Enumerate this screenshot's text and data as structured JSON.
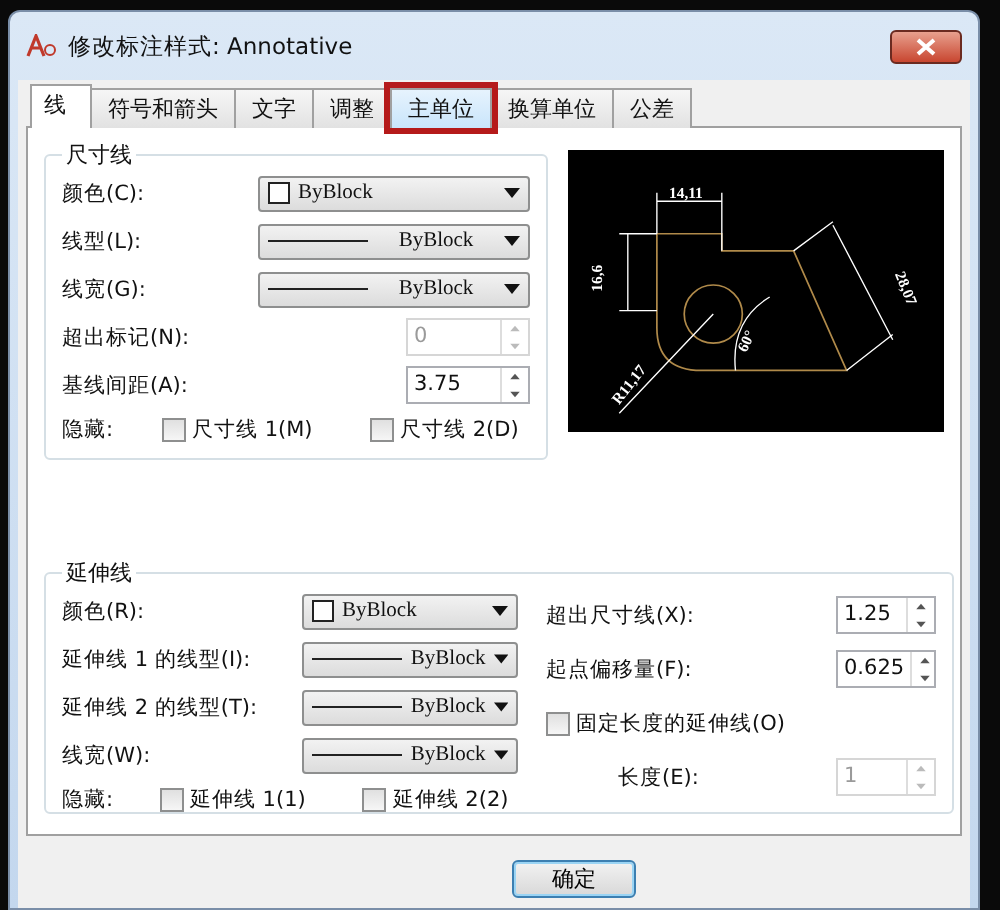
{
  "window": {
    "title": "修改标注样式: Annotative"
  },
  "tabs": [
    {
      "label": "线",
      "selected": true,
      "highlighted": false
    },
    {
      "label": "符号和箭头",
      "selected": false,
      "highlighted": false
    },
    {
      "label": "文字",
      "selected": false,
      "highlighted": false
    },
    {
      "label": "调整",
      "selected": false,
      "highlighted": false
    },
    {
      "label": "主单位",
      "selected": false,
      "highlighted": true
    },
    {
      "label": "换算单位",
      "selected": false,
      "highlighted": false
    },
    {
      "label": "公差",
      "selected": false,
      "highlighted": false
    }
  ],
  "dimension_lines": {
    "title": "尺寸线",
    "fields": [
      {
        "kind": "color_combo",
        "label": "颜色(C):",
        "value": "ByBlock"
      },
      {
        "kind": "line_combo",
        "label": "线型(L):",
        "value": "ByBlock"
      },
      {
        "kind": "line_combo",
        "label": "线宽(G):",
        "value": "ByBlock"
      },
      {
        "kind": "spinner",
        "label": "超出标记(N):",
        "value": "0",
        "disabled": true
      },
      {
        "kind": "spinner",
        "label": "基线间距(A):",
        "value": "3.75",
        "disabled": false
      }
    ],
    "hide": {
      "label": "隐藏:",
      "options": [
        {
          "label": "尺寸线 1(M)",
          "checked": false
        },
        {
          "label": "尺寸线 2(D)",
          "checked": false
        }
      ]
    }
  },
  "preview": {
    "labels": [
      "14,11",
      "16,6",
      "28,07",
      "60°",
      "R11,17"
    ]
  },
  "extension_lines": {
    "title": "延伸线",
    "fields": [
      {
        "kind": "color_combo",
        "label": "颜色(R):",
        "value": "ByBlock"
      },
      {
        "kind": "line_combo",
        "label": "延伸线 1 的线型(I):",
        "value": "ByBlock"
      },
      {
        "kind": "line_combo",
        "label": "延伸线 2 的线型(T):",
        "value": "ByBlock"
      },
      {
        "kind": "line_combo",
        "label": "线宽(W):",
        "value": "ByBlock"
      }
    ],
    "hide": {
      "label": "隐藏:",
      "options": [
        {
          "label": "延伸线 1(1)",
          "checked": false
        },
        {
          "label": "延伸线 2(2)",
          "checked": false
        }
      ]
    },
    "right_fields": [
      {
        "kind": "spinner",
        "label": "超出尺寸线(X):",
        "value": "1.25",
        "disabled": false
      },
      {
        "kind": "spinner",
        "label": "起点偏移量(F):",
        "value": "0.625",
        "disabled": false
      },
      {
        "kind": "checkbox",
        "label": "固定长度的延伸线(O)",
        "checked": false
      },
      {
        "kind": "spinner",
        "label": "长度(E):",
        "value": "1",
        "disabled": true
      }
    ]
  },
  "buttons": [
    {
      "label": "确定",
      "default": true
    }
  ]
}
